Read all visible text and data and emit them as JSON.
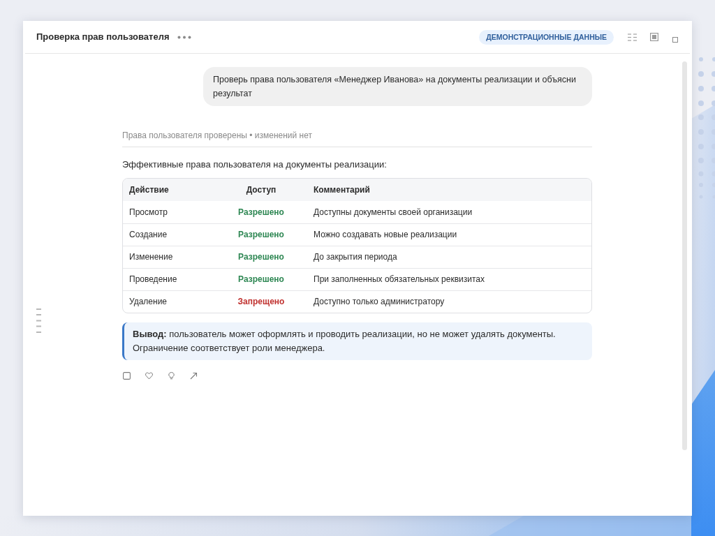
{
  "window": {
    "title": "Проверка прав пользователя",
    "badge": "ДЕМОНСТРАЦИОННЫЕ ДАННЫЕ"
  },
  "conversation": {
    "user_message": "Проверь права пользователя «Менеджер Иванова» на документы реализации и объясни результат",
    "reply": {
      "status": "Права пользователя проверены • изменений нет",
      "intro": "Эффективные права пользователя на документы реализации:",
      "table": {
        "columns": [
          "Действие",
          "Доступ",
          "Комментарий"
        ],
        "rows": [
          {
            "action": "Просмотр",
            "access": "Разрешено",
            "allowed": true,
            "comment": "Доступны документы своей организации"
          },
          {
            "action": "Создание",
            "access": "Разрешено",
            "allowed": true,
            "comment": "Можно создавать новые реализации"
          },
          {
            "action": "Изменение",
            "access": "Разрешено",
            "allowed": true,
            "comment": "До закрытия периода"
          },
          {
            "action": "Проведение",
            "access": "Разрешено",
            "allowed": true,
            "comment": "При заполненных обязательных реквизитах"
          },
          {
            "action": "Удаление",
            "access": "Запрещено",
            "allowed": false,
            "comment": "Доступно только администратору"
          }
        ]
      },
      "conclusion": "**Вывод:** пользователь может оформлять и проводить реализации, но не может удалять документы. Ограничение соответствует роли менеджера."
    }
  }
}
